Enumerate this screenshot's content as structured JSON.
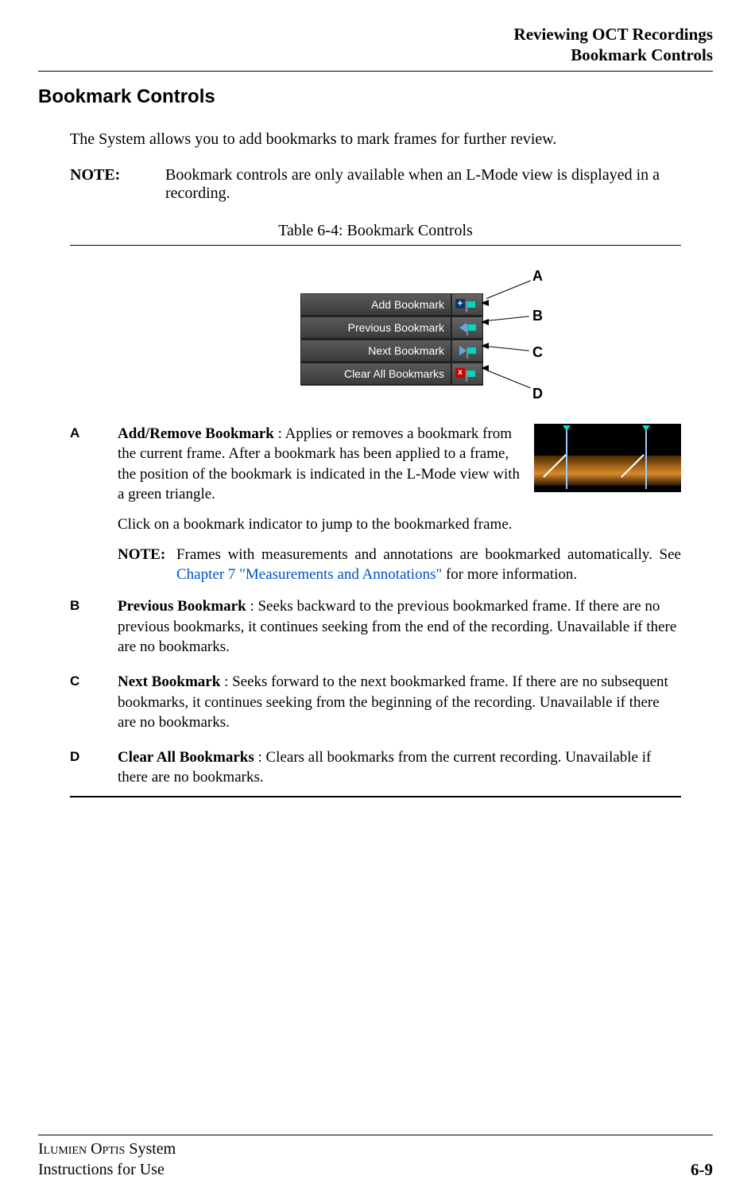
{
  "header": {
    "line1": "Reviewing OCT Recordings",
    "line2": "Bookmark Controls"
  },
  "section_title": "Bookmark Controls",
  "intro": "The System allows you to add bookmarks to mark frames for further review.",
  "top_note": {
    "label": "NOTE:",
    "text": "Bookmark controls are only available when an L-Mode view is displayed in a recording."
  },
  "table_caption": "Table 6-4:  Bookmark Controls",
  "toolbar": {
    "rows": [
      {
        "label": "Add Bookmark"
      },
      {
        "label": "Previous Bookmark"
      },
      {
        "label": "Next Bookmark"
      },
      {
        "label": "Clear All Bookmarks"
      }
    ]
  },
  "callouts": {
    "A": "A",
    "B": "B",
    "C": "C",
    "D": "D"
  },
  "items": {
    "A": {
      "title": "Add/Remove Bookmark",
      "text1": " : Applies or removes a bookmark from the current frame. After a bookmark has been applied to a frame, the position of the bookmark is indicated in the L-Mode view with a green triangle.",
      "para2": "Click on a bookmark indicator to jump to the bookmarked frame.",
      "sub_label": "NOTE:",
      "sub_text_pre": "Frames with measurements and annotations are bookmarked automatically. See ",
      "sub_link": "Chapter 7 \"Measurements and Annotations\"",
      "sub_text_post": " for more information."
    },
    "B": {
      "title": "Previous Bookmark",
      "text": " : Seeks backward to the previous bookmarked frame. If there are no previous bookmarks, it continues seeking from the end of the recording. Unavailable if there are no bookmarks."
    },
    "C": {
      "title": "Next Bookmark",
      "text": " : Seeks forward to the next bookmarked frame. If there are no subsequent bookmarks, it continues seeking from the beginning of the recording. Unavailable if there are no bookmarks."
    },
    "D": {
      "title": "Clear All Bookmarks",
      "text": " : Clears all bookmarks from the current recording. Unavailable if there are no bookmarks."
    }
  },
  "footer": {
    "line1_a": "Ilumien",
    "line1_b": " Optis",
    "line1_c": " System",
    "line2": "Instructions for Use",
    "page": "6-9"
  }
}
